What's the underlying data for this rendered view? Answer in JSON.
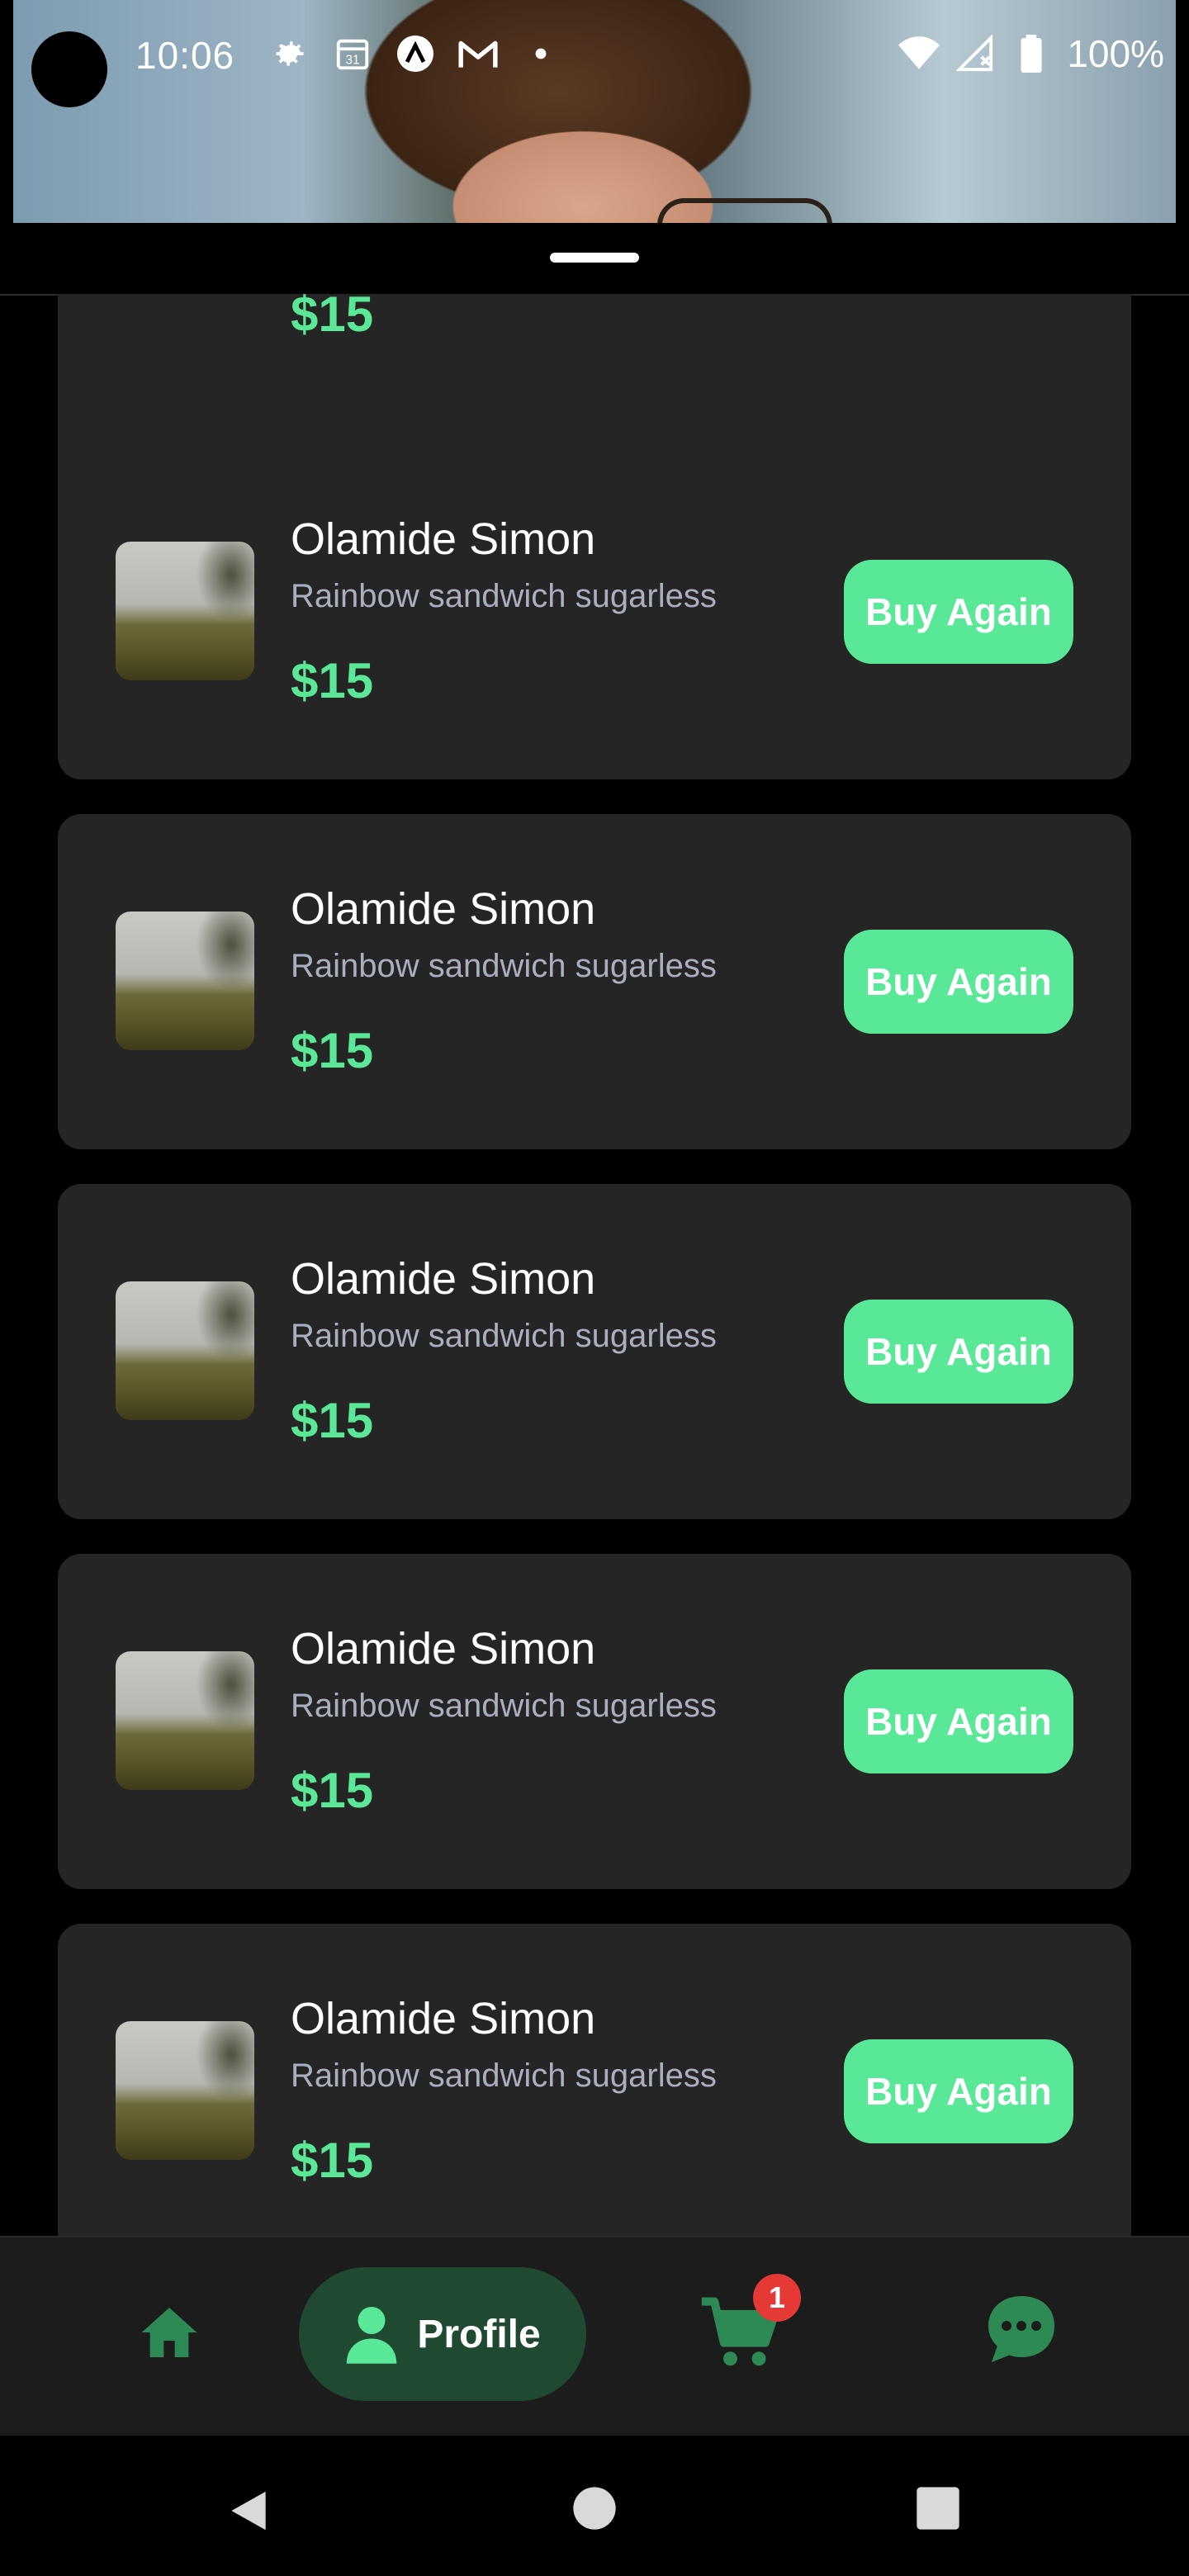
{
  "status_bar": {
    "time": "10:06",
    "battery": "100%",
    "icons": [
      "gear-icon",
      "calendar-icon",
      "app-icon",
      "gmail-icon",
      "dot-icon",
      "wifi-icon",
      "signal-icon",
      "battery-icon"
    ],
    "calendar_day": "31"
  },
  "orders": [
    {
      "name": "Olamide Simon",
      "description": "Rainbow sandwich sugarless",
      "price": "$15",
      "button": "Buy Again"
    },
    {
      "name": "Olamide Simon",
      "description": "Rainbow sandwich sugarless",
      "price": "$15",
      "button": "Buy Again"
    },
    {
      "name": "Olamide Simon",
      "description": "Rainbow sandwich sugarless",
      "price": "$15",
      "button": "Buy Again"
    },
    {
      "name": "Olamide Simon",
      "description": "Rainbow sandwich sugarless",
      "price": "$15",
      "button": "Buy Again"
    },
    {
      "name": "Olamide Simon",
      "description": "Rainbow sandwich sugarless",
      "price": "$15",
      "button": "Buy Again"
    }
  ],
  "partial_order": {
    "price": "$15"
  },
  "bottom_nav": {
    "items": [
      "home-icon",
      "profile-icon",
      "cart-icon",
      "chat-icon"
    ],
    "active_label": "Profile",
    "cart_badge": "1"
  },
  "colors": {
    "accent": "#59e898",
    "card_bg": "#252525",
    "nav_active_bg": "#1f4a31",
    "badge": "#e53935"
  }
}
